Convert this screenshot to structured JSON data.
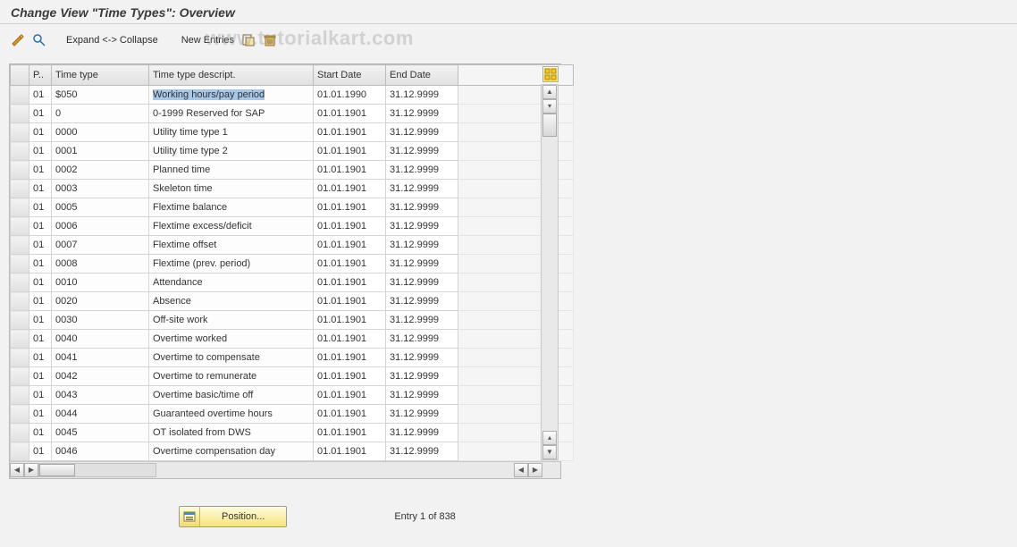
{
  "title": "Change View \"Time Types\": Overview",
  "watermark": "www.tutorialkart.com",
  "toolbar": {
    "expand_collapse": "Expand <-> Collapse",
    "new_entries": "New Entries"
  },
  "columns": {
    "p": "P..",
    "time_type": "Time type",
    "desc": "Time type descript.",
    "start": "Start Date",
    "end": "End Date"
  },
  "rows": [
    {
      "p": "01",
      "tt": "$050",
      "desc": "Working hours/pay period",
      "start": "01.01.1990",
      "end": "31.12.9999",
      "selected": true
    },
    {
      "p": "01",
      "tt": "0",
      "desc": "0-1999 Reserved for SAP",
      "start": "01.01.1901",
      "end": "31.12.9999"
    },
    {
      "p": "01",
      "tt": "0000",
      "desc": "Utility time type 1",
      "start": "01.01.1901",
      "end": "31.12.9999"
    },
    {
      "p": "01",
      "tt": "0001",
      "desc": "Utility time type 2",
      "start": "01.01.1901",
      "end": "31.12.9999"
    },
    {
      "p": "01",
      "tt": "0002",
      "desc": "Planned time",
      "start": "01.01.1901",
      "end": "31.12.9999"
    },
    {
      "p": "01",
      "tt": "0003",
      "desc": "Skeleton time",
      "start": "01.01.1901",
      "end": "31.12.9999"
    },
    {
      "p": "01",
      "tt": "0005",
      "desc": "Flextime balance",
      "start": "01.01.1901",
      "end": "31.12.9999"
    },
    {
      "p": "01",
      "tt": "0006",
      "desc": "Flextime excess/deficit",
      "start": "01.01.1901",
      "end": "31.12.9999"
    },
    {
      "p": "01",
      "tt": "0007",
      "desc": "Flextime offset",
      "start": "01.01.1901",
      "end": "31.12.9999"
    },
    {
      "p": "01",
      "tt": "0008",
      "desc": "Flextime (prev. period)",
      "start": "01.01.1901",
      "end": "31.12.9999"
    },
    {
      "p": "01",
      "tt": "0010",
      "desc": "Attendance",
      "start": "01.01.1901",
      "end": "31.12.9999"
    },
    {
      "p": "01",
      "tt": "0020",
      "desc": "Absence",
      "start": "01.01.1901",
      "end": "31.12.9999"
    },
    {
      "p": "01",
      "tt": "0030",
      "desc": "Off-site work",
      "start": "01.01.1901",
      "end": "31.12.9999"
    },
    {
      "p": "01",
      "tt": "0040",
      "desc": "Overtime worked",
      "start": "01.01.1901",
      "end": "31.12.9999"
    },
    {
      "p": "01",
      "tt": "0041",
      "desc": "Overtime to compensate",
      "start": "01.01.1901",
      "end": "31.12.9999"
    },
    {
      "p": "01",
      "tt": "0042",
      "desc": "Overtime to remunerate",
      "start": "01.01.1901",
      "end": "31.12.9999"
    },
    {
      "p": "01",
      "tt": "0043",
      "desc": "Overtime basic/time off",
      "start": "01.01.1901",
      "end": "31.12.9999"
    },
    {
      "p": "01",
      "tt": "0044",
      "desc": "Guaranteed overtime hours",
      "start": "01.01.1901",
      "end": "31.12.9999"
    },
    {
      "p": "01",
      "tt": "0045",
      "desc": "OT isolated from DWS",
      "start": "01.01.1901",
      "end": "31.12.9999"
    },
    {
      "p": "01",
      "tt": "0046",
      "desc": "Overtime compensation day",
      "start": "01.01.1901",
      "end": "31.12.9999"
    }
  ],
  "footer": {
    "position_label": "Position...",
    "entry_info": "Entry 1 of 838"
  }
}
